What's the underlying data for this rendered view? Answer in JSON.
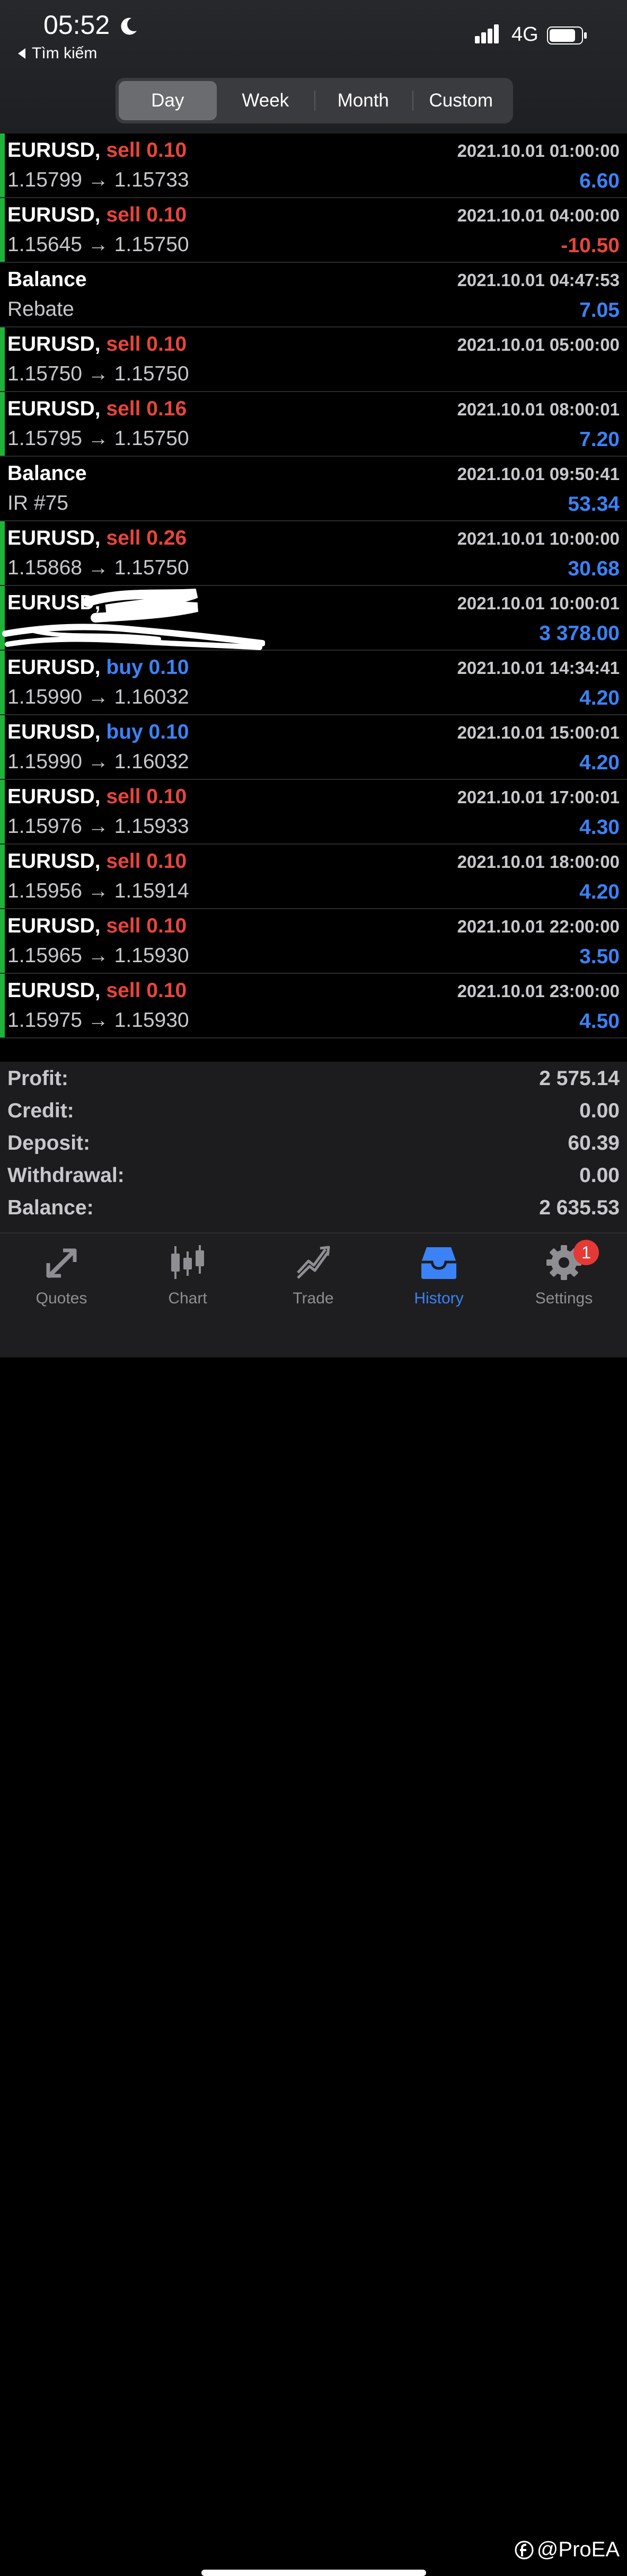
{
  "status_bar": {
    "time": "05:52",
    "back_label": "Tìm kiếm",
    "network": "4G"
  },
  "segments": [
    {
      "label": "Day",
      "active": true
    },
    {
      "label": "Week",
      "active": false
    },
    {
      "label": "Month",
      "active": false
    },
    {
      "label": "Custom",
      "active": false
    }
  ],
  "rows": [
    {
      "kind": "trade",
      "symbol": "EURUSD,",
      "side": "sell 0.10",
      "side_type": "sell",
      "prices": "1.15799 → 1.15733",
      "date": "2021.10.01 01:00:00",
      "amount": "6.60",
      "amount_type": "pos"
    },
    {
      "kind": "trade",
      "symbol": "EURUSD,",
      "side": "sell 0.10",
      "side_type": "sell",
      "prices": "1.15645 → 1.15750",
      "date": "2021.10.01 04:00:00",
      "amount": "-10.50",
      "amount_type": "neg"
    },
    {
      "kind": "balance",
      "symbol": "Balance",
      "side": "",
      "side_type": "",
      "prices": "Rebate",
      "date": "2021.10.01 04:47:53",
      "amount": "7.05",
      "amount_type": "pos"
    },
    {
      "kind": "trade",
      "symbol": "EURUSD,",
      "side": "sell 0.10",
      "side_type": "sell",
      "prices": "1.15750 → 1.15750",
      "date": "2021.10.01 05:00:00",
      "amount": "",
      "amount_type": "pos"
    },
    {
      "kind": "trade",
      "symbol": "EURUSD,",
      "side": "sell 0.16",
      "side_type": "sell",
      "prices": "1.15795 → 1.15750",
      "date": "2021.10.01 08:00:01",
      "amount": "7.20",
      "amount_type": "pos"
    },
    {
      "kind": "balance",
      "symbol": "Balance",
      "side": "",
      "side_type": "",
      "prices": "IR #75",
      "date": "2021.10.01 09:50:41",
      "amount": "53.34",
      "amount_type": "pos"
    },
    {
      "kind": "trade",
      "symbol": "EURUSD,",
      "side": "sell 0.26",
      "side_type": "sell",
      "prices": "1.15868 → 1.15750",
      "date": "2021.10.01 10:00:00",
      "amount": "30.68",
      "amount_type": "pos"
    },
    {
      "kind": "trade",
      "symbol": "EURUSD,",
      "side": "",
      "side_type": "buy",
      "prices": "",
      "date": "2021.10.01 10:00:01",
      "amount": "3 378.00",
      "amount_type": "pos",
      "redacted": true
    },
    {
      "kind": "trade",
      "symbol": "EURUSD,",
      "side": "buy 0.10",
      "side_type": "buy",
      "prices": "1.15990 → 1.16032",
      "date": "2021.10.01 14:34:41",
      "amount": "4.20",
      "amount_type": "pos"
    },
    {
      "kind": "trade",
      "symbol": "EURUSD,",
      "side": "buy 0.10",
      "side_type": "buy",
      "prices": "1.15990 → 1.16032",
      "date": "2021.10.01 15:00:01",
      "amount": "4.20",
      "amount_type": "pos"
    },
    {
      "kind": "trade",
      "symbol": "EURUSD,",
      "side": "sell 0.10",
      "side_type": "sell",
      "prices": "1.15976 → 1.15933",
      "date": "2021.10.01 17:00:01",
      "amount": "4.30",
      "amount_type": "pos"
    },
    {
      "kind": "trade",
      "symbol": "EURUSD,",
      "side": "sell 0.10",
      "side_type": "sell",
      "prices": "1.15956 → 1.15914",
      "date": "2021.10.01 18:00:00",
      "amount": "4.20",
      "amount_type": "pos"
    },
    {
      "kind": "trade",
      "symbol": "EURUSD,",
      "side": "sell 0.10",
      "side_type": "sell",
      "prices": "1.15965 → 1.15930",
      "date": "2021.10.01 22:00:00",
      "amount": "3.50",
      "amount_type": "pos"
    },
    {
      "kind": "trade",
      "symbol": "EURUSD,",
      "side": "sell 0.10",
      "side_type": "sell",
      "prices": "1.15975 → 1.15930",
      "date": "2021.10.01 23:00:00",
      "amount": "4.50",
      "amount_type": "pos"
    }
  ],
  "summary": [
    {
      "label": "Profit:",
      "value": "2 575.14"
    },
    {
      "label": "Credit:",
      "value": "0.00"
    },
    {
      "label": "Deposit:",
      "value": "60.39"
    },
    {
      "label": "Withdrawal:",
      "value": "0.00"
    },
    {
      "label": "Balance:",
      "value": "2 635.53"
    }
  ],
  "tabs": [
    {
      "label": "Quotes",
      "icon": "quotes-icon",
      "active": false
    },
    {
      "label": "Chart",
      "icon": "chart-icon",
      "active": false
    },
    {
      "label": "Trade",
      "icon": "trade-icon",
      "active": false
    },
    {
      "label": "History",
      "icon": "history-icon",
      "active": true
    },
    {
      "label": "Settings",
      "icon": "gear-icon",
      "active": false,
      "badge": "1"
    }
  ],
  "watermark": "@ProEA",
  "colors": {
    "sell": "#e8453c",
    "buy": "#3b82f6",
    "positive": "#3b82f6",
    "negative": "#e8453c",
    "trade_marker": "#1fb33a"
  }
}
